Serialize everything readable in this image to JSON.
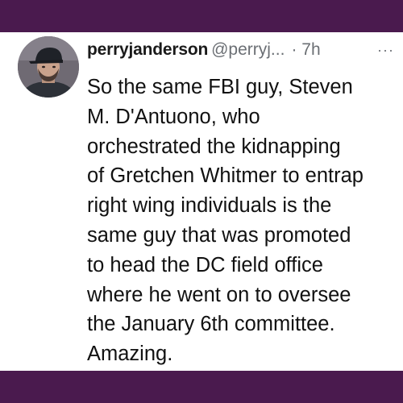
{
  "colors": {
    "frame_bar": "#4a1a4e",
    "text_primary": "#111111",
    "text_secondary": "#6b6f74"
  },
  "tweet": {
    "avatar_icon": "profile-photo",
    "username": "perryjanderson",
    "handle": "@perryj...",
    "separator": "·",
    "time": "7h",
    "more_label": "···",
    "text_lines": [
      "So the same FBI guy, Steven",
      "M. D'Antuono, who",
      "orchestrated the kidnapping",
      "of Gretchen Whitmer to entrap",
      "right wing individuals is the",
      "same guy that was promoted",
      "to head the DC field office",
      "where he went on to oversee",
      "the January 6th committee.",
      "Amazing."
    ]
  }
}
